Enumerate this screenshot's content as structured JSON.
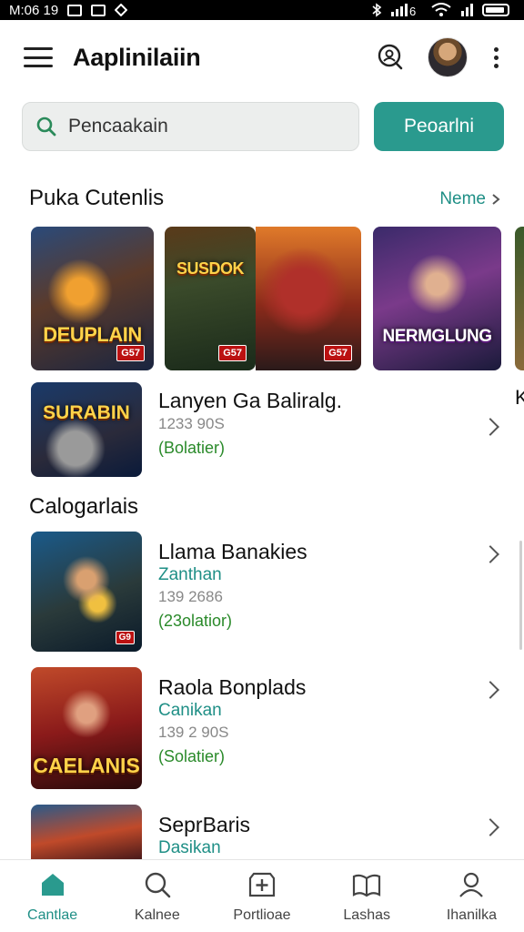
{
  "status_bar": {
    "time": "M:06 19"
  },
  "app_bar": {
    "title": "Aaplinilaiin"
  },
  "search": {
    "placeholder": "Pencaakain",
    "button_label": "Peoarlni"
  },
  "featured_section": {
    "title": "Puka Cutenlis",
    "more_label": "Neme",
    "cards": [
      {
        "logo": "DEUPLAIN",
        "badge": "G57"
      },
      {
        "logo": "SUSDOK",
        "badge": "G57"
      },
      {
        "logo": "",
        "badge": "G57"
      },
      {
        "logo": "NERMGLUNG",
        "badge": ""
      }
    ]
  },
  "featured_item": {
    "logo": "SURABIN",
    "name": "Lanyen Ga Baliralg.",
    "number": "1233 90S",
    "status": "(Bolatier)",
    "peek_char": "K"
  },
  "categories_section": {
    "title": "Calogarlais",
    "items": [
      {
        "name": "Llama Banakies",
        "sub": "Zanthan",
        "number": "139 2686",
        "status": "(23olatior)",
        "badge": "G9"
      },
      {
        "name": "Raola Bonplads",
        "sub": "Canikan",
        "number": "139 2 90S",
        "status": "(Solatier)",
        "logo": "CAELANIS"
      },
      {
        "name": "SeprBaris",
        "sub": "Dasikan"
      }
    ]
  },
  "bottom_nav": [
    {
      "label": "Cantlae",
      "icon": "home-icon"
    },
    {
      "label": "Kalnee",
      "icon": "search-icon"
    },
    {
      "label": "Portlioae",
      "icon": "add-box-icon"
    },
    {
      "label": "Lashas",
      "icon": "library-icon"
    },
    {
      "label": "Ihanilka",
      "icon": "profile-icon"
    }
  ],
  "colors": {
    "accent": "#2a9a8e",
    "link": "#1f8f86",
    "status_green": "#2a8a2a"
  }
}
